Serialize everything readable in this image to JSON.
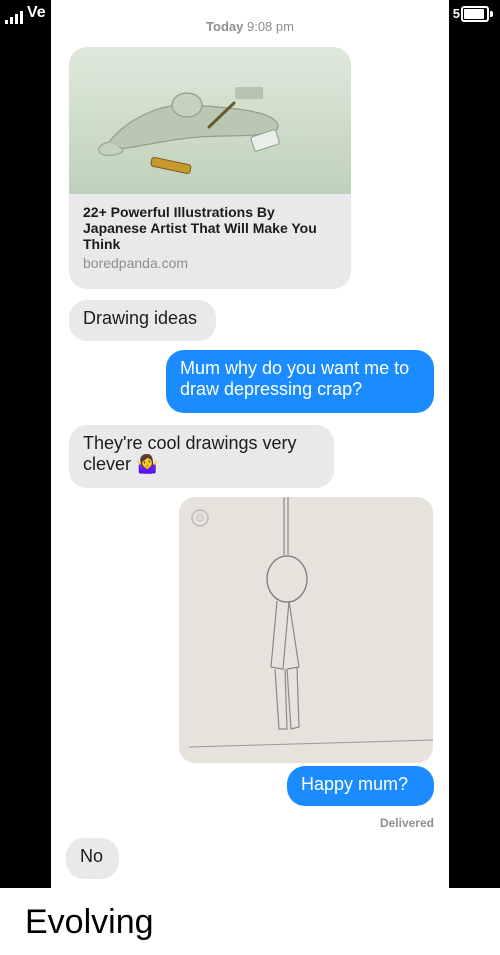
{
  "status_bar": {
    "carrier": "Ve",
    "battery_text": "5"
  },
  "thread": {
    "timestamp_day": "Today",
    "timestamp_time": "9:08 pm",
    "link_preview": {
      "title": "22+ Powerful Illustrations By Japanese Artist That Will Make You Think",
      "domain": "boredpanda.com",
      "image_icon": "illustration-image"
    },
    "messages": [
      {
        "direction": "incoming",
        "text": "Drawing ideas"
      },
      {
        "direction": "outgoing",
        "text": "Mum why do you want me to draw depressing crap?"
      },
      {
        "direction": "incoming",
        "text": "They're cool drawings very clever 🤷‍♀️"
      },
      {
        "direction": "outgoing",
        "image_icon": "pencil-drawing-image"
      },
      {
        "direction": "outgoing",
        "text": "Happy mum?"
      },
      {
        "direction": "incoming",
        "text": "No"
      }
    ],
    "delivery_status": "Delivered"
  },
  "caption": "Evolving",
  "colors": {
    "outgoing_bubble": "#1a8cff",
    "incoming_bubble": "#e9e9eb",
    "meta_gray": "#8e8e93"
  }
}
